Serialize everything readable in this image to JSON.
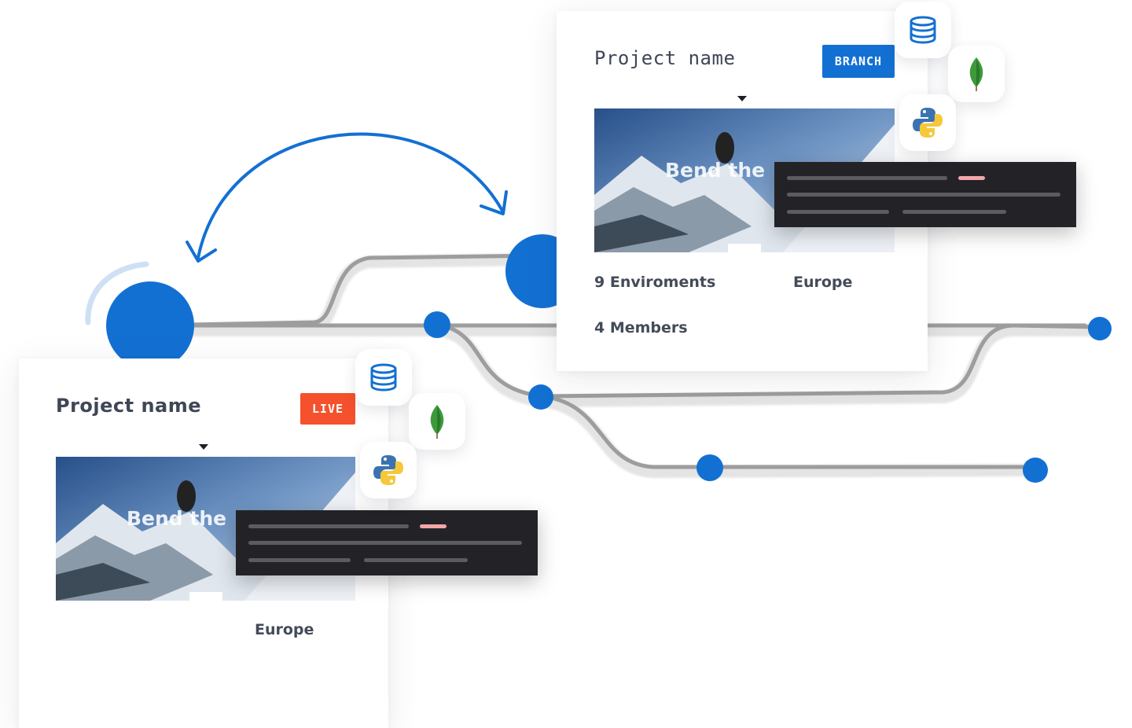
{
  "colors": {
    "accent": "#1370d3",
    "live": "#f4512c",
    "branch": "#1370d3",
    "code_bg": "#232327",
    "track": "#9a9a9a"
  },
  "icons": [
    "database-icon",
    "mongodb-leaf-icon",
    "python-icon",
    "swap-arrow-icon"
  ],
  "branch_card": {
    "title": "Project name",
    "badge": "BRANCH",
    "preview_headline": "Bend the",
    "environments": "9 Enviroments",
    "region": "Europe",
    "members": "4 Members"
  },
  "live_card": {
    "title": "Project name",
    "badge": "LIVE",
    "preview_headline": "Bend the",
    "region": "Europe"
  }
}
